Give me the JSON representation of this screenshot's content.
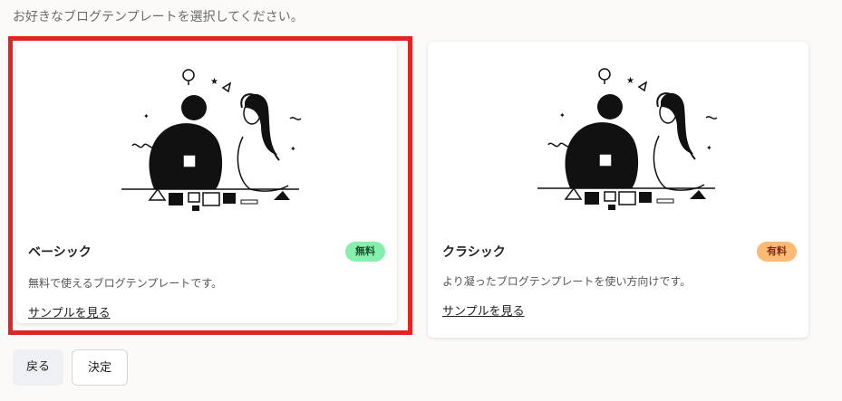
{
  "instruction": "お好きなブログテンプレートを選択してください。",
  "templates": [
    {
      "title": "ベーシック",
      "badge": "無料",
      "description": "無料で使えるブログテンプレートです。",
      "sample_link": "サンプルを見る",
      "selected": true
    },
    {
      "title": "クラシック",
      "badge": "有料",
      "description": "より凝ったブログテンプレートを使い方向けです。",
      "sample_link": "サンプルを見る",
      "selected": false
    }
  ],
  "buttons": {
    "back": "戻る",
    "confirm": "決定"
  },
  "colors": {
    "selected_outline": "#e32320",
    "free_badge": "#86efac",
    "paid_badge": "#fdba74"
  }
}
